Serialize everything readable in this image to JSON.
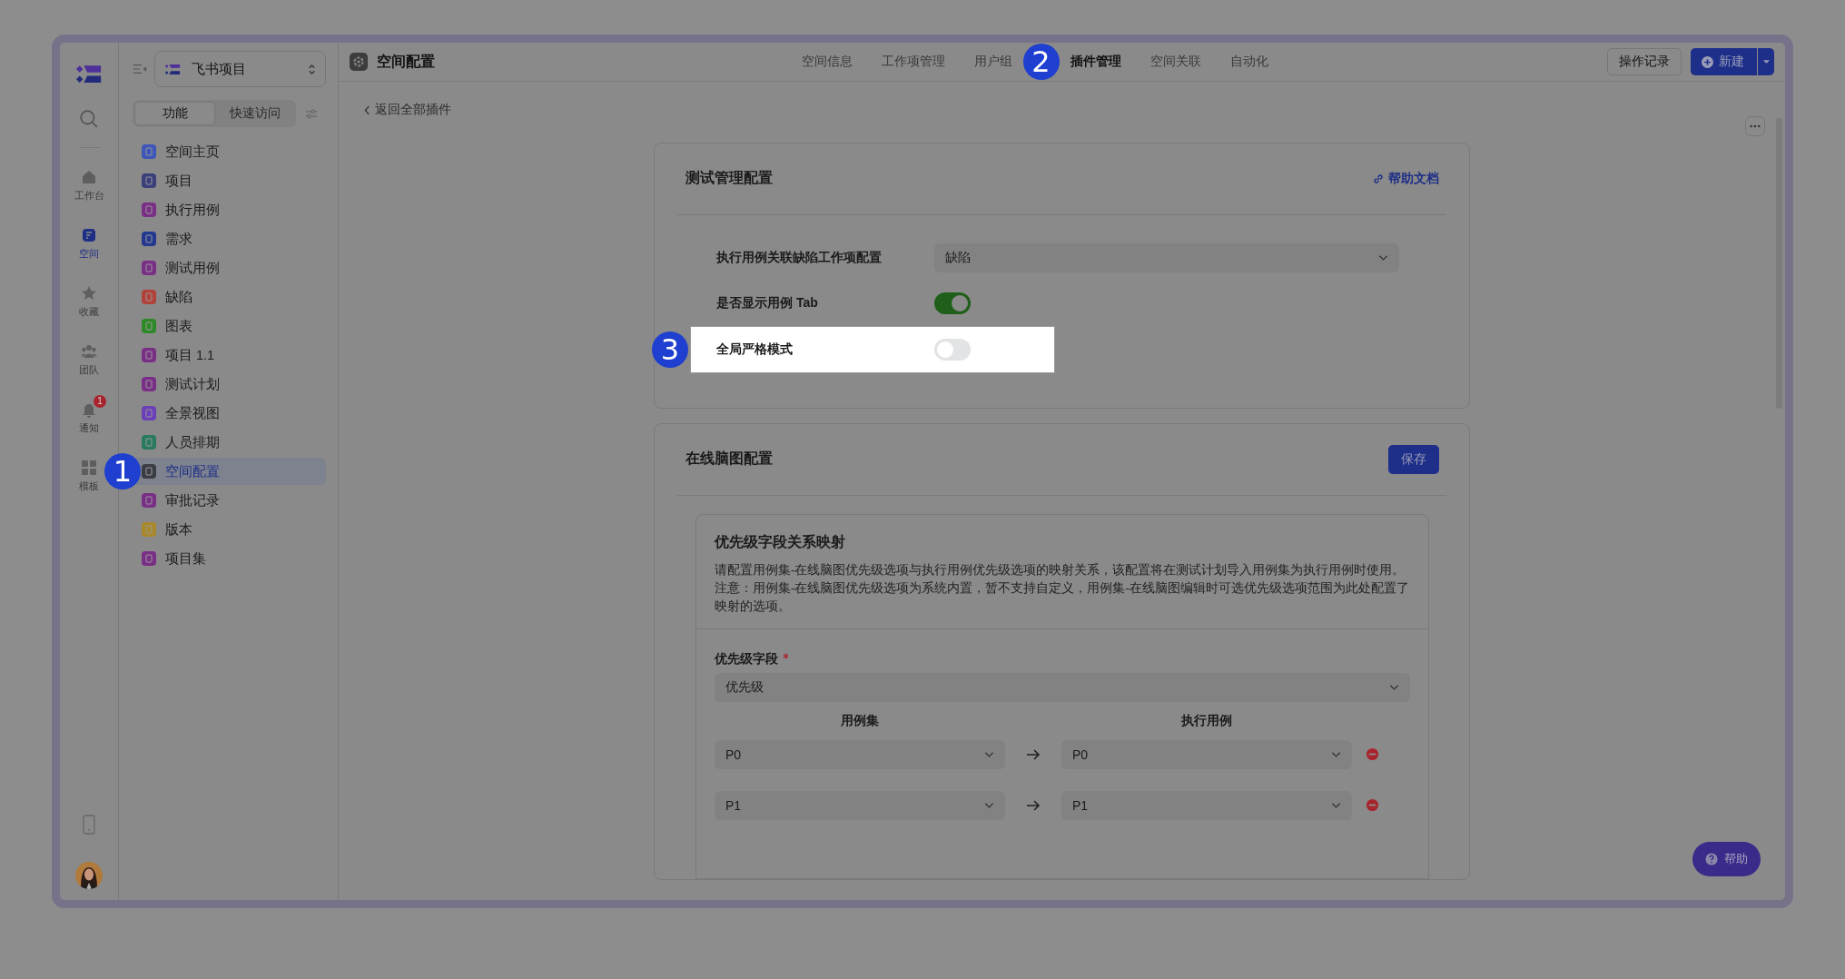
{
  "rail": {
    "items": [
      {
        "kind": "home",
        "label": "工作台",
        "selected": false
      },
      {
        "kind": "space",
        "label": "空间",
        "selected": true
      },
      {
        "kind": "star",
        "label": "收藏",
        "selected": false
      },
      {
        "kind": "team",
        "label": "团队",
        "selected": false
      },
      {
        "kind": "bell",
        "label": "通知",
        "selected": false,
        "badge": "1"
      },
      {
        "kind": "grid",
        "label": "模板",
        "selected": false
      }
    ]
  },
  "sidebar": {
    "project": "飞书项目",
    "tabs": [
      {
        "label": "功能",
        "selected": true
      },
      {
        "label": "快速访问",
        "selected": false
      }
    ],
    "items": [
      {
        "label": "空间主页",
        "color": "#3d56b8",
        "selected": false
      },
      {
        "label": "项目",
        "color": "#3b3f7a",
        "selected": false
      },
      {
        "label": "执行用例",
        "color": "#7a2f86",
        "selected": false
      },
      {
        "label": "需求",
        "color": "#23388f",
        "selected": false
      },
      {
        "label": "测试用例",
        "color": "#7a2f86",
        "selected": false
      },
      {
        "label": "缺陷",
        "color": "#b0423a",
        "selected": false
      },
      {
        "label": "图表",
        "color": "#2e8a28",
        "selected": false
      },
      {
        "label": "项目 1.1",
        "color": "#7a2f86",
        "selected": false
      },
      {
        "label": "测试计划",
        "color": "#7a2f86",
        "selected": false
      },
      {
        "label": "全景视图",
        "color": "#6a3fb8",
        "selected": false
      },
      {
        "label": "人员排期",
        "color": "#2a7a5f",
        "selected": false
      },
      {
        "label": "空间配置",
        "color": "#3a3d45",
        "selected": true,
        "marker": "1"
      },
      {
        "label": "审批记录",
        "color": "#7a2f86",
        "selected": false
      },
      {
        "label": "版本",
        "color": "#a8882a",
        "selected": false
      },
      {
        "label": "项目集",
        "color": "#7a2f86",
        "selected": false
      }
    ]
  },
  "header": {
    "title": "空间配置",
    "tabs": [
      {
        "label": "空间信息",
        "selected": false
      },
      {
        "label": "工作项管理",
        "selected": false
      },
      {
        "label": "用户组",
        "selected": false
      },
      {
        "label": "插件管理",
        "selected": true,
        "marker": "2"
      },
      {
        "label": "空间关联",
        "selected": false
      },
      {
        "label": "自动化",
        "selected": false
      }
    ],
    "history_button": "操作记录",
    "new_button": "新建"
  },
  "back_link": "返回全部插件",
  "test_config": {
    "title": "测试管理配置",
    "help_link": "帮助文档",
    "rows": [
      {
        "kind": "select",
        "label": "执行用例关联缺陷工作项配置",
        "value": "缺陷",
        "highlighted": false
      },
      {
        "kind": "toggle",
        "label": "是否显示用例 Tab",
        "on": true,
        "highlighted": false
      },
      {
        "kind": "toggle",
        "label": "全局严格模式",
        "on": false,
        "highlighted": true,
        "marker": "3"
      }
    ]
  },
  "mindmap_config": {
    "title": "在线脑图配置",
    "save_button": "保存",
    "section": {
      "title": "优先级字段关系映射",
      "description": [
        "请配置用例集-在线脑图优先级选项与执行用例优先级选项的映射关系，该配置将在测试计划导入用例集为执行用例时使用。",
        "注意：用例集-在线脑图优先级选项为系统内置，暂不支持自定义，用例集-在线脑图编辑时可选优先级选项范围为此处配置了映射的选项。"
      ],
      "field_label": "优先级字段",
      "required": true,
      "field_value": "优先级",
      "columns": [
        "用例集",
        "执行用例"
      ],
      "mappings": [
        {
          "from": "P0",
          "to": "P0"
        },
        {
          "from": "P1",
          "to": "P1"
        }
      ]
    }
  },
  "help_button": "帮助"
}
